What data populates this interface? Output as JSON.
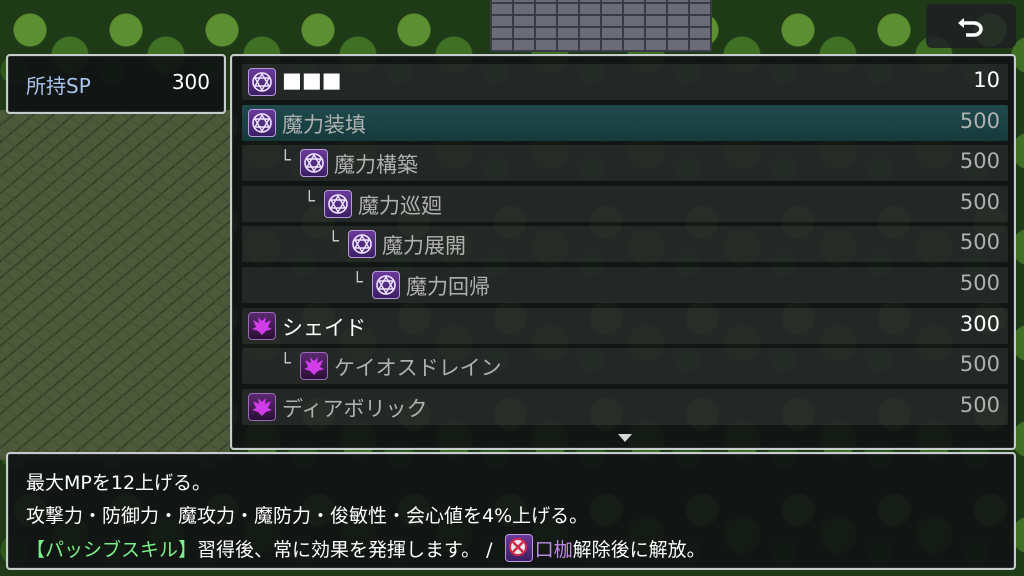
{
  "sp": {
    "label": "所持SP",
    "value": "300"
  },
  "skills": [
    {
      "label": "■■■",
      "cost": "10",
      "depth": 0,
      "icon": "hexagram-icon",
      "state": "learned"
    },
    {
      "label": "魔力装填",
      "cost": "500",
      "depth": 0,
      "icon": "hexagram-icon",
      "state": "unlearned",
      "selected": true
    },
    {
      "label": "魔力構築",
      "cost": "500",
      "depth": 1,
      "icon": "hexagram-icon",
      "state": "unlearned"
    },
    {
      "label": "魔力巡廻",
      "cost": "500",
      "depth": 2,
      "icon": "hexagram-icon",
      "state": "unlearned"
    },
    {
      "label": "魔力展開",
      "cost": "500",
      "depth": 3,
      "icon": "hexagram-icon",
      "state": "unlearned"
    },
    {
      "label": "魔力回帰",
      "cost": "500",
      "depth": 4,
      "icon": "hexagram-icon",
      "state": "unlearned"
    },
    {
      "label": "シェイド",
      "cost": "300",
      "depth": 0,
      "icon": "demon-wings-icon",
      "state": "learned"
    },
    {
      "label": "ケイオスドレイン",
      "cost": "500",
      "depth": 1,
      "icon": "demon-wings-icon",
      "state": "unlearned"
    },
    {
      "label": "ディアボリック",
      "cost": "500",
      "depth": 0,
      "icon": "demon-wings-icon",
      "state": "unlearned"
    }
  ],
  "branch_glyph": "└",
  "help": {
    "line1": "最大MPを12上げる。",
    "line2": "攻撃力・防御力・魔攻力・魔防力・俊敏性・会心値を4%上げる。",
    "passive_tag": "【パッシブスキル】",
    "line3_rest": "習得後、常に効果を発揮します。 / ",
    "lock_name": "口枷",
    "unlock_text": "解除後に解放。"
  },
  "colors": {
    "selected_row": "#1f4a4c",
    "passive_tag": "#7cf08a",
    "lock_name": "#c08ae8",
    "sp_label": "#a8c4ec"
  }
}
